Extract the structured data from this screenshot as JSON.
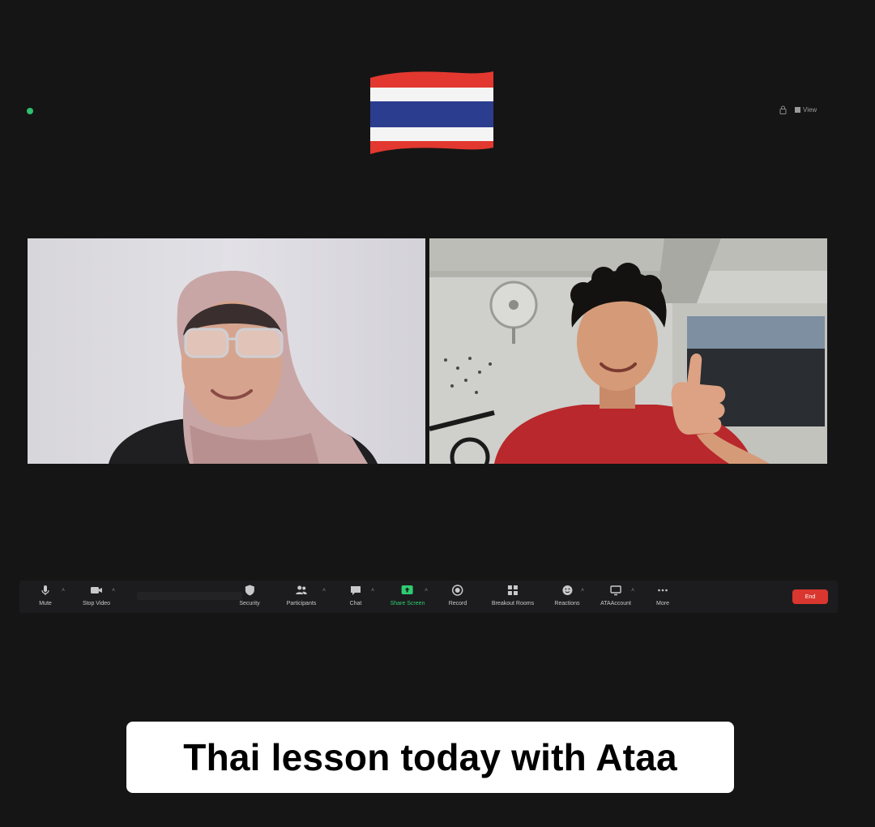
{
  "colors": {
    "background": "#151515",
    "toolbar": "#1c1c1e",
    "share_accent": "#2ecc71",
    "end_button": "#d9362f",
    "caption_bg": "#ffffff"
  },
  "header": {
    "flag_icon": "thailand-flag",
    "view_label": "View"
  },
  "participants": [
    {
      "position": "left",
      "shirt_color": "#1f1f22",
      "scarf_color": "#c9a6a6"
    },
    {
      "position": "right",
      "shirt_color": "#b8282c",
      "gesture": "thumbs-up"
    }
  ],
  "toolbar": {
    "mute_label": "Mute",
    "video_label": "Stop Video",
    "security_label": "Security",
    "participants_label": "Participants",
    "chat_label": "Chat",
    "share_label": "Share Screen",
    "record_label": "Record",
    "breakout_label": "Breakout Rooms",
    "reactions_label": "Reactions",
    "apps_label": "ATAAccount",
    "more_label": "More",
    "end_label": "End"
  },
  "caption": {
    "text": "Thai lesson today with Ataa"
  }
}
